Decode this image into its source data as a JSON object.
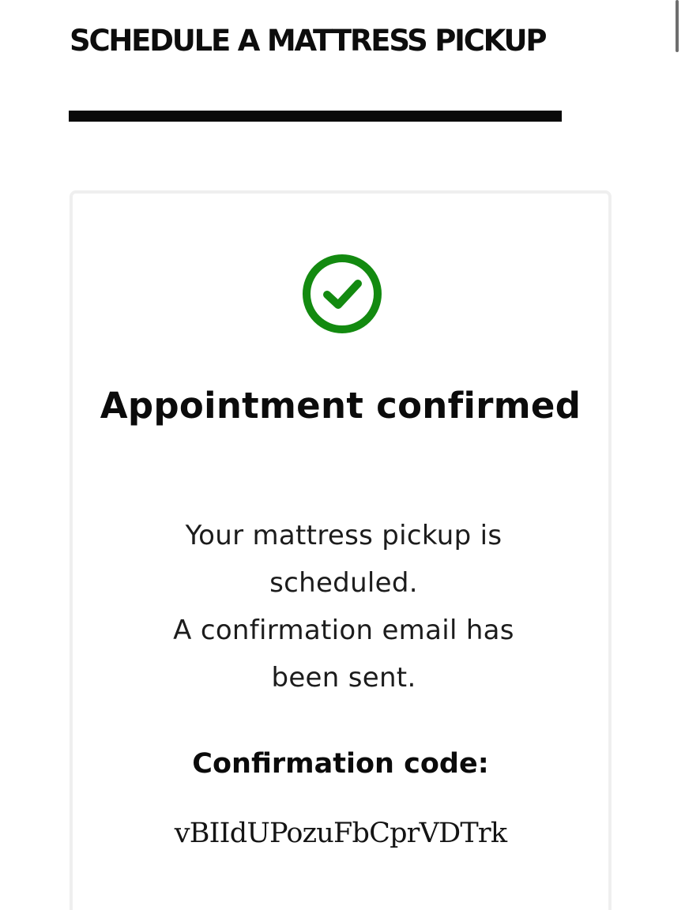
{
  "page": {
    "title": "SCHEDULE A MATTRESS PICKUP"
  },
  "confirmation": {
    "icon": "check-circle-icon",
    "icon_color": "#138a10",
    "heading": "Appointment confirmed",
    "message_line_1": "Your mattress pickup is scheduled.",
    "message_line_2": "A confirmation email has been sent.",
    "code_label": "Confirmation code:",
    "code_value": "vBIIdUPozuFbCprVDTrk"
  }
}
